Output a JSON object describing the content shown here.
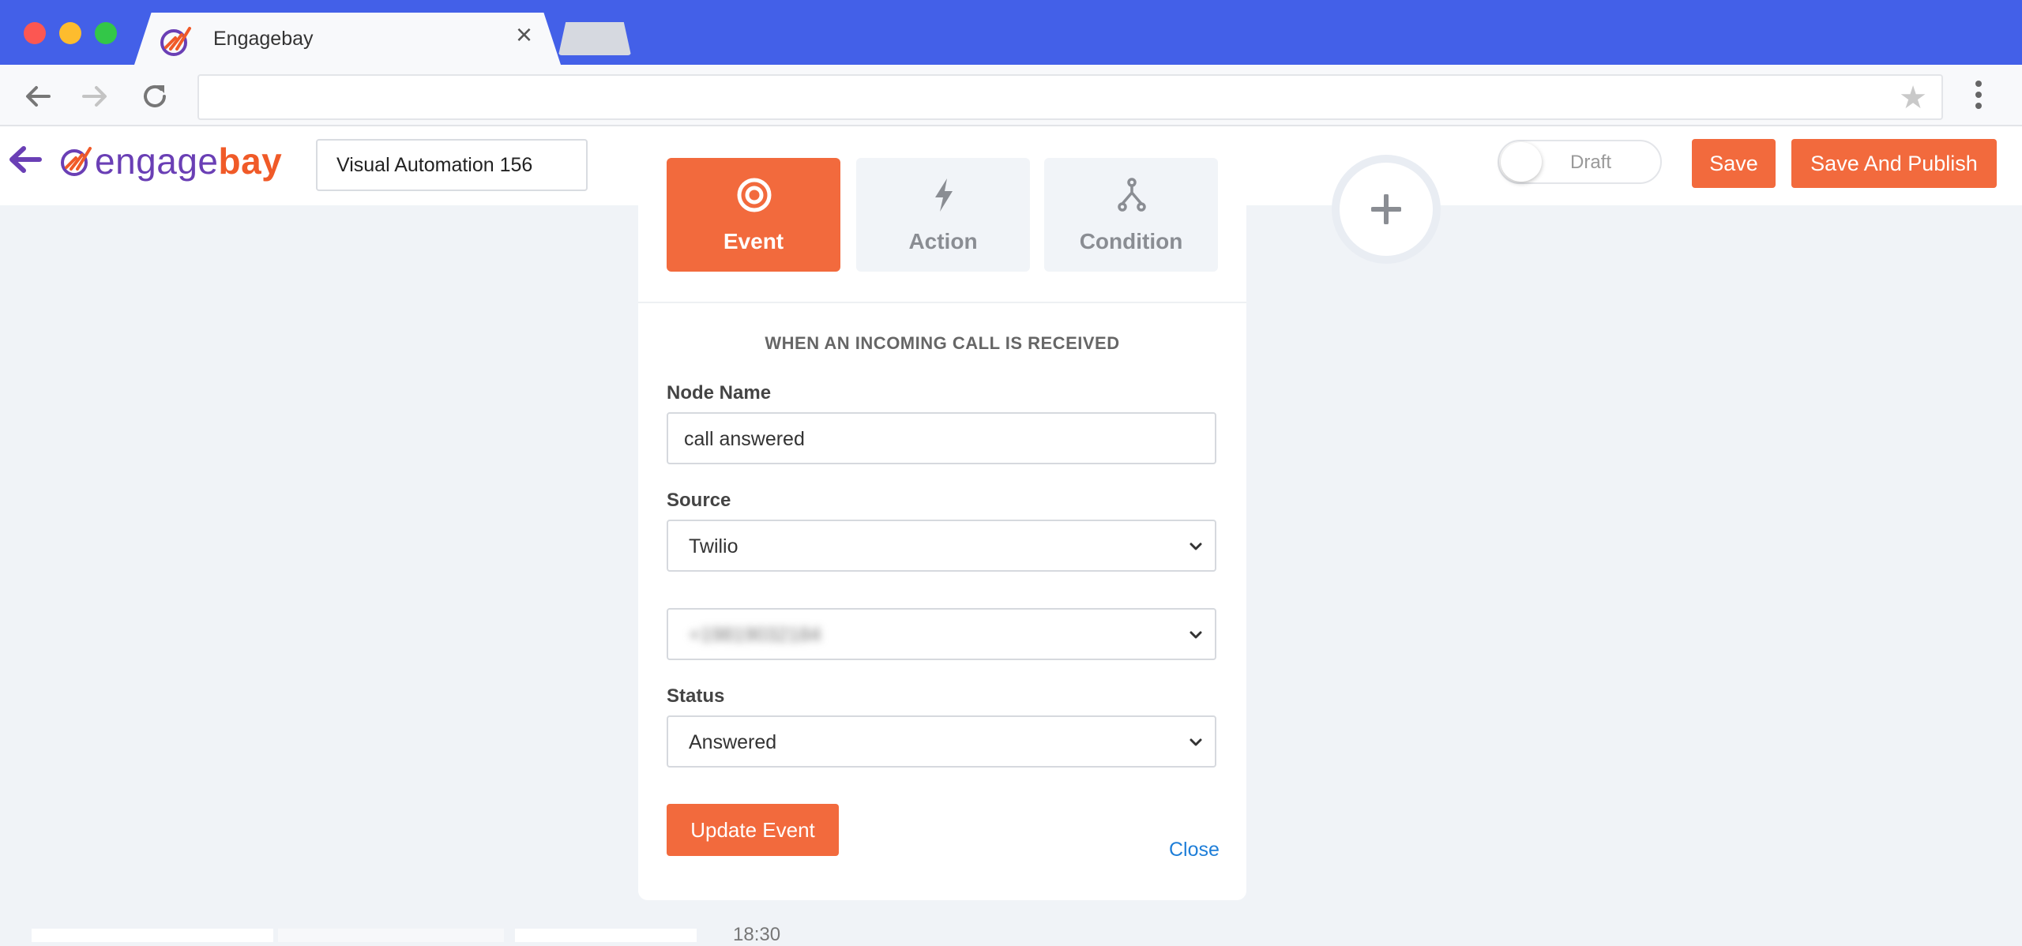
{
  "browser": {
    "tab_title": "Engagebay",
    "tab_close": "×",
    "url": ""
  },
  "header": {
    "brand_part1": "engage",
    "brand_part2": "bay",
    "automation_name": "Visual Automation 156",
    "toggle_label": "Draft",
    "save_label": "Save",
    "publish_label": "Save And Publish"
  },
  "panel": {
    "tabs": [
      {
        "label": "Event",
        "icon": "target-icon",
        "active": true
      },
      {
        "label": "Action",
        "icon": "lightning-icon",
        "active": false
      },
      {
        "label": "Condition",
        "icon": "branch-icon",
        "active": false
      }
    ],
    "heading": "WHEN AN INCOMING CALL IS RECEIVED",
    "node_name_label": "Node Name",
    "node_name_value": "call answered",
    "source_label": "Source",
    "source_value": "Twilio",
    "phone_value": "+19819032184",
    "status_label": "Status",
    "status_value": "Answered",
    "update_label": "Update Event",
    "close_label": "Close"
  },
  "canvas": {
    "time_label": "18:30"
  },
  "colors": {
    "chrome_blue": "#4360e8",
    "accent_orange": "#f26a3d",
    "brand_purple": "#6a3fb5",
    "link_blue": "#1e7ed8"
  }
}
